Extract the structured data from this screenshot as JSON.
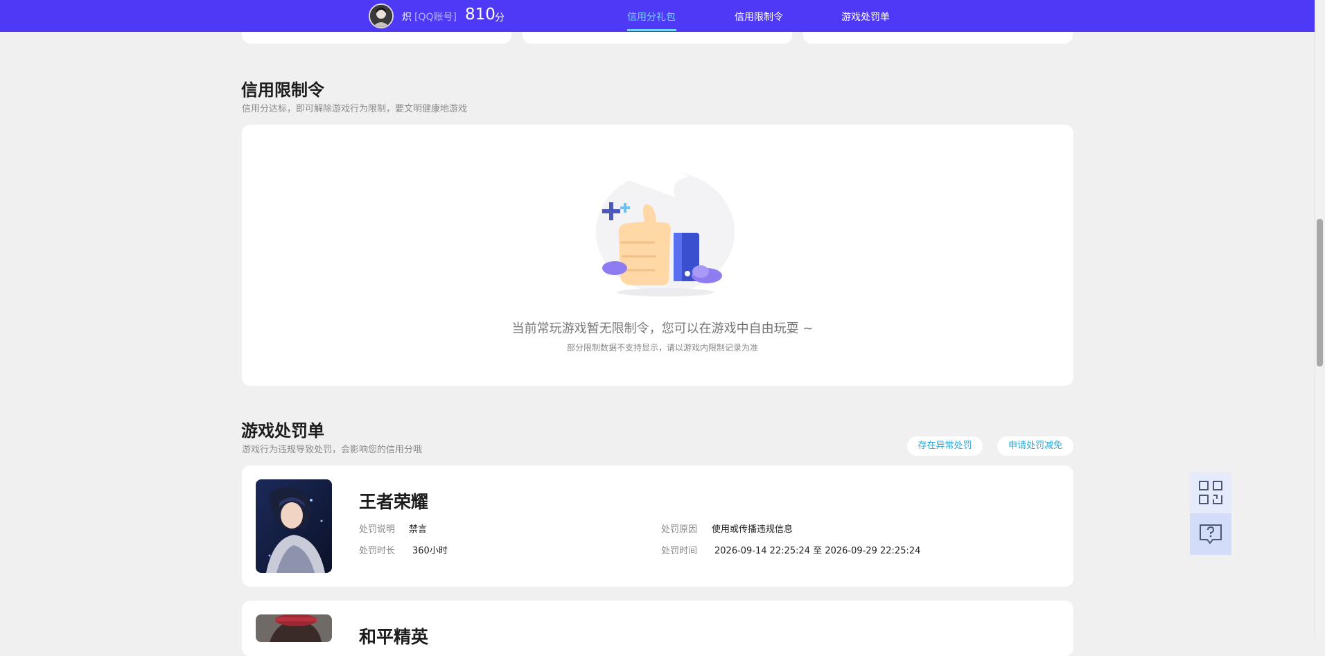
{
  "header": {
    "user_name": "炽",
    "account_type": "[QQ账号]",
    "score": "810",
    "score_unit": "分",
    "nav": [
      "信用分礼包",
      "信用限制令",
      "游戏处罚单"
    ],
    "active_nav": "信用分礼包"
  },
  "restriction": {
    "title": "信用限制令",
    "subtitle": "信用分达标，即可解除游戏行为限制，要文明健康地游戏",
    "empty_main": "当前常玩游戏暂无限制令，您可以在游戏中自由玩耍 ~",
    "empty_sub": "部分限制数据不支持显示，请以游戏内限制记录为准"
  },
  "penalty": {
    "title": "游戏处罚单",
    "subtitle": "游戏行为违规导致处罚，会影响您的信用分哦",
    "btn_abnormal": "存在异常处罚",
    "btn_reduce": "申请处罚减免",
    "games": [
      {
        "name": "王者荣耀",
        "desc_label": "处罚说明",
        "desc": "禁言",
        "reason_label": "处罚原因",
        "reason": "使用或传播违规信息",
        "duration_label": "处罚时长",
        "duration": "360小时",
        "time_label": "处罚时间",
        "time": "2026-09-14 22:25:24 至 2026-09-29 22:25:24"
      },
      {
        "name": "和平精英"
      }
    ]
  },
  "colors": {
    "topbar": "#4e39f6",
    "active_nav": "#73d3ff",
    "accent_link": "#2aa8d8",
    "background": "#f0f0f0"
  },
  "icons": {
    "side1": "qr-code-icon",
    "side2": "feedback-question-icon"
  }
}
